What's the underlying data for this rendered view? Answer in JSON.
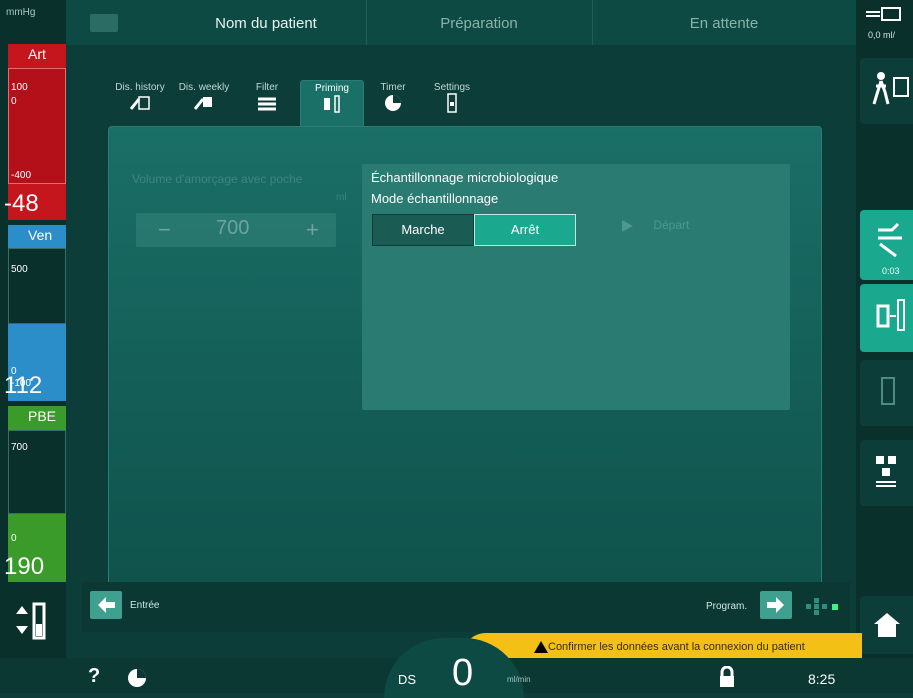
{
  "top": {
    "patient_name": "Nom du patient",
    "phase": "Préparation",
    "status": "En attente"
  },
  "left": {
    "unit": "mmHg",
    "art": {
      "label": "Art",
      "scale_top": "100",
      "scale_zero": "0",
      "scale_bottom": "-400",
      "value": "-48"
    },
    "ven": {
      "label": "Ven",
      "scale_top": "500",
      "scale_zero": "0",
      "scale_bottom": "-100",
      "value": "112"
    },
    "pbe": {
      "label": "PBE",
      "scale_top": "700",
      "scale_bottom": "0",
      "value": "190"
    }
  },
  "right": {
    "top_readout": "0,0  ml/",
    "timer": "0:03"
  },
  "tabs": [
    {
      "label": "Dis. history",
      "icon": "dis-history-icon"
    },
    {
      "label": "Dis. weekly",
      "icon": "dis-weekly-icon"
    },
    {
      "label": "Filter",
      "icon": "filter-icon"
    },
    {
      "label": "Priming",
      "icon": "priming-icon"
    },
    {
      "label": "Timer",
      "icon": "timer-icon"
    },
    {
      "label": "Settings",
      "icon": "settings-icon"
    }
  ],
  "priming": {
    "volume_label": "Volume d'amorçage avec poche",
    "volume_unit": "ml",
    "volume_value": "700",
    "minus": "−",
    "plus": "+",
    "micro_title": "Échantillonnage microbiologique",
    "mode_label": "Mode échantillonnage",
    "btn_on": "Marche",
    "btn_off": "Arrêt",
    "start_label": "Départ"
  },
  "nav": {
    "back_label": "Entrée",
    "next_label": "Program."
  },
  "warning": "Confirmer les données avant la connexion du patient",
  "status": {
    "help": "?",
    "flow_label": "DS",
    "flow_value": "0",
    "flow_unit": "ml/min",
    "time": "8:25"
  },
  "colors": {
    "art": "#c4161c",
    "ven": "#2b8ec9",
    "pbe": "#3a9a2a",
    "accent": "#1aa88f",
    "warning": "#f3c116"
  }
}
